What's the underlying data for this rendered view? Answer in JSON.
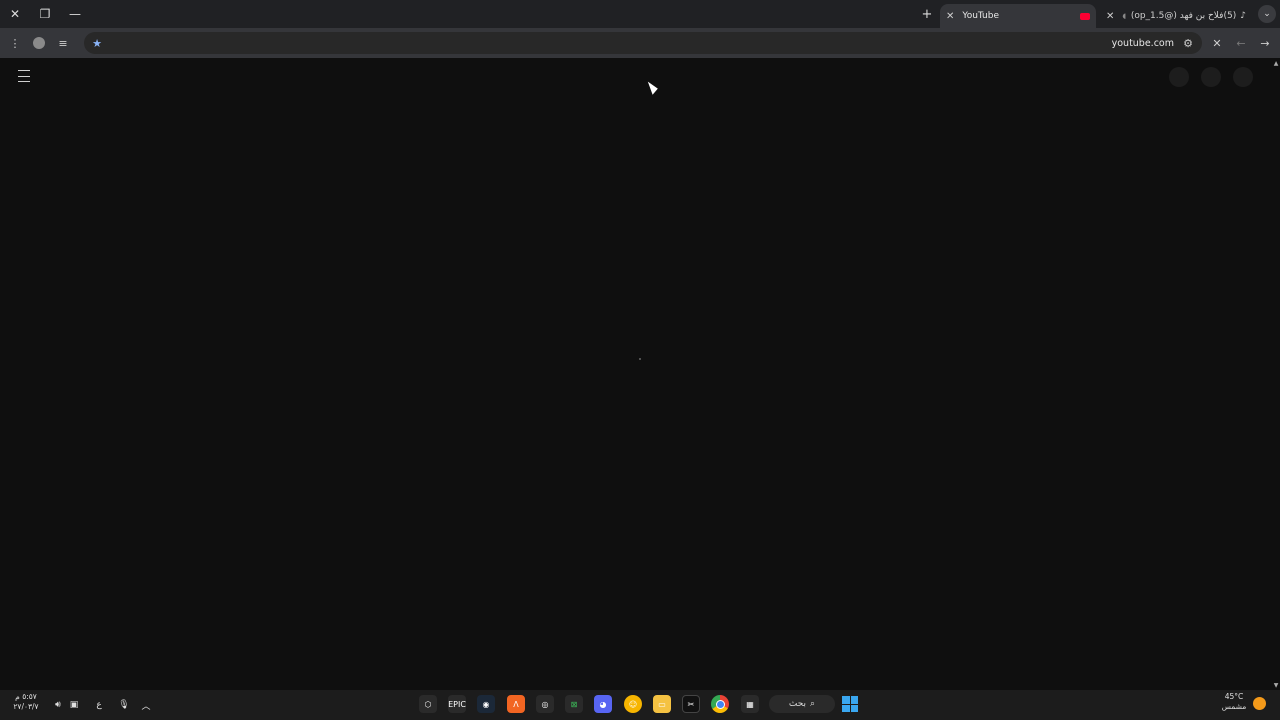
{
  "window": {
    "close_glyph": "✕",
    "restore_glyph": "❐",
    "minimize_glyph": "—"
  },
  "tabs": [
    {
      "title": "YouTube",
      "active": true
    },
    {
      "title": "(5)فلاح بن فهد (@op_1.5) |",
      "active": false
    }
  ],
  "toolbar": {
    "url": "youtube.com"
  },
  "taskbar": {
    "clock_time": "٥:٥٧ م",
    "clock_date": "٢٧/٠٣/٧",
    "lang": "ع",
    "search_label": "بحث",
    "weather_temp": "45°C",
    "weather_desc": "مشمس"
  },
  "colors": {
    "accent_windows": "#3aa7f0",
    "sun": "#f49a1a",
    "youtube_red": "#ff0033"
  }
}
